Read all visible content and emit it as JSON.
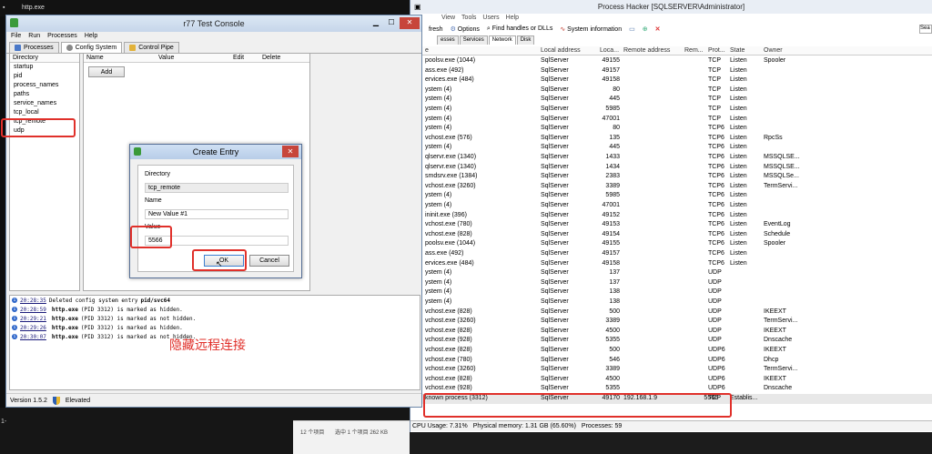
{
  "background": {
    "files": [
      "http.exe"
    ],
    "gutter_text": "1-",
    "explorer": {
      "count": "12 个项目",
      "selected": "选中 1 个项目 262 KB"
    }
  },
  "r77": {
    "title": "r77 Test Console",
    "menu": [
      "File",
      "Run",
      "Processes",
      "Help"
    ],
    "tabs": [
      "Processes",
      "Config System",
      "Control Pipe"
    ],
    "dir_header": "Directory",
    "directories": [
      "startup",
      "pid",
      "process_names",
      "paths",
      "service_names",
      "tcp_local",
      "tcp_remote",
      "udp"
    ],
    "value_headers": [
      "Name",
      "Value",
      "Edit",
      "Delete"
    ],
    "add_label": "Add",
    "log": [
      {
        "time": "20:28:35",
        "pre": "Deleted config system entry",
        "bold": "pid/svc64",
        "post": ""
      },
      {
        "time": "20:28:59",
        "pre": "",
        "bold": "http.exe",
        "post": "(PID 3312) is marked as hidden."
      },
      {
        "time": "20:29:21",
        "pre": "",
        "bold": "http.exe",
        "post": "(PID 3312) is marked as not hidden."
      },
      {
        "time": "20:29:26",
        "pre": "",
        "bold": "http.exe",
        "post": "(PID 3312) is marked as hidden."
      },
      {
        "time": "20:30:07",
        "pre": "",
        "bold": "http.exe",
        "post": "(PID 3312) is marked as not hidden."
      }
    ],
    "annotation": "隐藏远程连接",
    "version": "Version 1.5.2",
    "elevated": "Elevated"
  },
  "dialog": {
    "title": "Create Entry",
    "dir_label": "Directory",
    "dir_value": "tcp_remote",
    "name_label": "Name",
    "name_value": "New Value #1",
    "value_label": "Value",
    "value_value": "5566",
    "ok": "OK",
    "cancel": "Cancel"
  },
  "ph": {
    "title": "Process Hacker [SQLSERVER\\Administrator]",
    "menu": [
      "View",
      "Tools",
      "Users",
      "Help"
    ],
    "toolbar": [
      "fresh",
      "Options",
      "Find handles or DLLs",
      "System information"
    ],
    "tabs": [
      "esses",
      "Services",
      "Network",
      "Disk"
    ],
    "search": "Sea",
    "columns": [
      "e",
      "Local address",
      "Loca...",
      "Remote address",
      "Rem...",
      "Prot...",
      "State",
      "Owner"
    ],
    "rows": [
      [
        "poolsv.exe (1044)",
        "SqlServer",
        "49155",
        "",
        "",
        "TCP",
        "Listen",
        "Spooler"
      ],
      [
        "ass.exe (492)",
        "SqlServer",
        "49157",
        "",
        "",
        "TCP",
        "Listen",
        ""
      ],
      [
        "ervices.exe (484)",
        "SqlServer",
        "49158",
        "",
        "",
        "TCP",
        "Listen",
        ""
      ],
      [
        "ystem (4)",
        "SqlServer",
        "80",
        "",
        "",
        "TCP",
        "Listen",
        ""
      ],
      [
        "ystem (4)",
        "SqlServer",
        "445",
        "",
        "",
        "TCP",
        "Listen",
        ""
      ],
      [
        "ystem (4)",
        "SqlServer",
        "5985",
        "",
        "",
        "TCP",
        "Listen",
        ""
      ],
      [
        "ystem (4)",
        "SqlServer",
        "47001",
        "",
        "",
        "TCP",
        "Listen",
        ""
      ],
      [
        "ystem (4)",
        "SqlServer",
        "80",
        "",
        "",
        "TCP6",
        "Listen",
        ""
      ],
      [
        "vchost.exe (576)",
        "SqlServer",
        "135",
        "",
        "",
        "TCP6",
        "Listen",
        "RpcSs"
      ],
      [
        "ystem (4)",
        "SqlServer",
        "445",
        "",
        "",
        "TCP6",
        "Listen",
        ""
      ],
      [
        "qlservr.exe (1340)",
        "SqlServer",
        "1433",
        "",
        "",
        "TCP6",
        "Listen",
        "MSSQLSE..."
      ],
      [
        "qlservr.exe (1340)",
        "SqlServer",
        "1434",
        "",
        "",
        "TCP6",
        "Listen",
        "MSSQLSE..."
      ],
      [
        "smdsrv.exe (1384)",
        "SqlServer",
        "2383",
        "",
        "",
        "TCP6",
        "Listen",
        "MSSQLSe..."
      ],
      [
        "vchost.exe (3260)",
        "SqlServer",
        "3389",
        "",
        "",
        "TCP6",
        "Listen",
        "TermServi..."
      ],
      [
        "ystem (4)",
        "SqlServer",
        "5985",
        "",
        "",
        "TCP6",
        "Listen",
        ""
      ],
      [
        "ystem (4)",
        "SqlServer",
        "47001",
        "",
        "",
        "TCP6",
        "Listen",
        ""
      ],
      [
        "ininit.exe (396)",
        "SqlServer",
        "49152",
        "",
        "",
        "TCP6",
        "Listen",
        ""
      ],
      [
        "vchost.exe (780)",
        "SqlServer",
        "49153",
        "",
        "",
        "TCP6",
        "Listen",
        "EventLog"
      ],
      [
        "vchost.exe (828)",
        "SqlServer",
        "49154",
        "",
        "",
        "TCP6",
        "Listen",
        "Schedule"
      ],
      [
        "poolsv.exe (1044)",
        "SqlServer",
        "49155",
        "",
        "",
        "TCP6",
        "Listen",
        "Spooler"
      ],
      [
        "ass.exe (492)",
        "SqlServer",
        "49157",
        "",
        "",
        "TCP6",
        "Listen",
        ""
      ],
      [
        "ervices.exe (484)",
        "SqlServer",
        "49158",
        "",
        "",
        "TCP6",
        "Listen",
        ""
      ],
      [
        "ystem (4)",
        "SqlServer",
        "137",
        "",
        "",
        "UDP",
        "",
        ""
      ],
      [
        "ystem (4)",
        "SqlServer",
        "137",
        "",
        "",
        "UDP",
        "",
        ""
      ],
      [
        "ystem (4)",
        "SqlServer",
        "138",
        "",
        "",
        "UDP",
        "",
        ""
      ],
      [
        "ystem (4)",
        "SqlServer",
        "138",
        "",
        "",
        "UDP",
        "",
        ""
      ],
      [
        "vchost.exe (828)",
        "SqlServer",
        "500",
        "",
        "",
        "UDP",
        "",
        "IKEEXT"
      ],
      [
        "vchost.exe (3260)",
        "SqlServer",
        "3389",
        "",
        "",
        "UDP",
        "",
        "TermServi..."
      ],
      [
        "vchost.exe (828)",
        "SqlServer",
        "4500",
        "",
        "",
        "UDP",
        "",
        "IKEEXT"
      ],
      [
        "vchost.exe (928)",
        "SqlServer",
        "5355",
        "",
        "",
        "UDP",
        "",
        "Dnscache"
      ],
      [
        "vchost.exe (828)",
        "SqlServer",
        "500",
        "",
        "",
        "UDP6",
        "",
        "IKEEXT"
      ],
      [
        "vchost.exe (780)",
        "SqlServer",
        "546",
        "",
        "",
        "UDP6",
        "",
        "Dhcp"
      ],
      [
        "vchost.exe (3260)",
        "SqlServer",
        "3389",
        "",
        "",
        "UDP6",
        "",
        "TermServi..."
      ],
      [
        "vchost.exe (828)",
        "SqlServer",
        "4500",
        "",
        "",
        "UDP6",
        "",
        "IKEEXT"
      ],
      [
        "vchost.exe (928)",
        "SqlServer",
        "5355",
        "",
        "",
        "UDP6",
        "",
        "Dnscache"
      ],
      [
        "known process (3312)",
        "SqlServer",
        "49170",
        "192.168.1.9",
        "5566",
        "TCP",
        "Establis...",
        ""
      ]
    ],
    "status": {
      "cpu": "CPU Usage: 7.31%",
      "mem": "Physical memory: 1.31 GB (65.60%)",
      "procs": "Processes: 59"
    }
  }
}
